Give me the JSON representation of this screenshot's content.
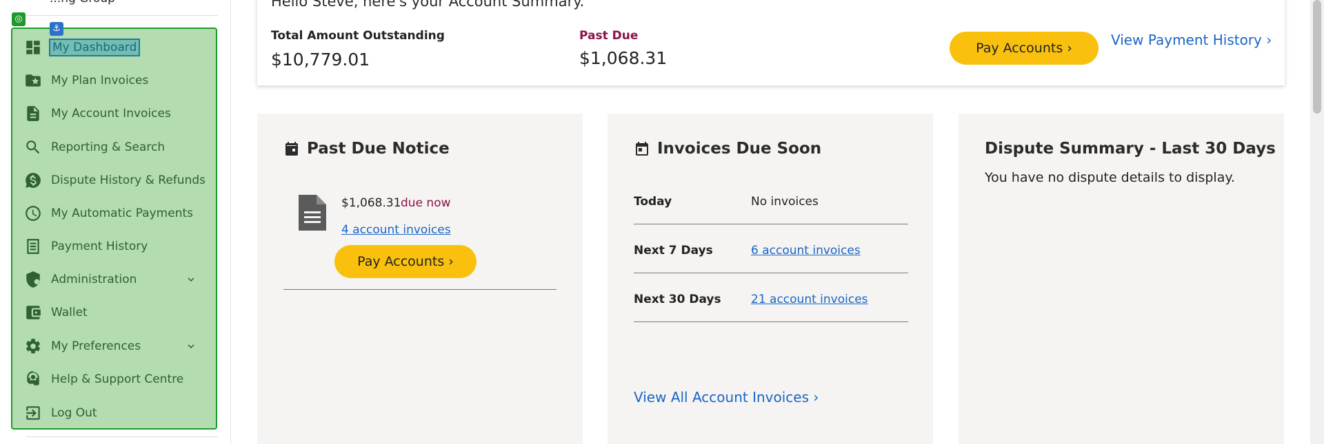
{
  "sidebar": {
    "cut_text": "...ng Group",
    "items": [
      {
        "label": "My Dashboard",
        "icon": "dashboard-icon"
      },
      {
        "label": "My Plan Invoices",
        "icon": "folder-star-icon"
      },
      {
        "label": "My Account Invoices",
        "icon": "document-icon"
      },
      {
        "label": "Reporting & Search",
        "icon": "search-icon"
      },
      {
        "label": "Dispute History & Refunds",
        "icon": "dollar-chat-icon"
      },
      {
        "label": "My Automatic Payments",
        "icon": "clock-icon"
      },
      {
        "label": "Payment History",
        "icon": "receipt-icon"
      },
      {
        "label": "Administration",
        "icon": "shield-user-icon"
      },
      {
        "label": "Wallet",
        "icon": "wallet-icon"
      },
      {
        "label": "My Preferences",
        "icon": "gear-icon"
      },
      {
        "label": "Help & Support Centre",
        "icon": "headset-icon"
      },
      {
        "label": "Log Out",
        "icon": "logout-icon"
      }
    ]
  },
  "summary": {
    "greeting": "Hello Steve, here's your Account Summary.",
    "total_label": "Total Amount Outstanding",
    "total_value": "$10,779.01",
    "past_due_label": "Past Due",
    "past_due_value": "$1,068.31",
    "pay_label": "Pay Accounts ›",
    "history_label": "View Payment History ›"
  },
  "past_due_notice": {
    "title": "Past Due Notice",
    "amount": "$1,068.31",
    "due": "due now",
    "link": "4 account invoices",
    "pay_label": "Pay Accounts ›"
  },
  "due_soon": {
    "title": "Invoices Due Soon",
    "rows": [
      {
        "label": "Today",
        "value": "No invoices"
      },
      {
        "label": "Next 7 Days",
        "value": "6 account invoices"
      },
      {
        "label": "Next 30 Days",
        "value": "21 account invoices"
      }
    ],
    "view_all": "View All Account Invoices ›"
  },
  "dispute": {
    "title": "Dispute Summary - Last 30 Days",
    "text": "You have no dispute details to display."
  },
  "colors": {
    "accent_yellow": "#f9c10d",
    "link_blue": "#1a64c6",
    "past_due_red": "#8b1246",
    "nav_green": "#b3ddb0"
  }
}
